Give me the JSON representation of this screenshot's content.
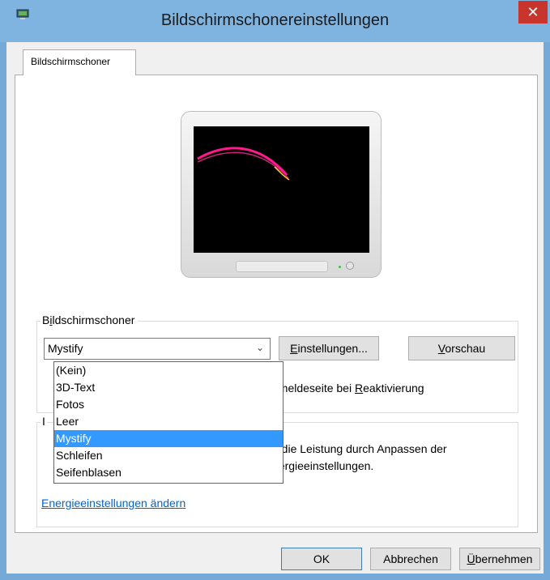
{
  "window": {
    "title": "Bildschirmschonereinstellungen",
    "close_glyph": "✕"
  },
  "tabs": [
    {
      "label": "Bildschirmschoner"
    }
  ],
  "screensaver": {
    "group_label_pre": "B",
    "group_label_accel": "i",
    "group_label_post": "ldschirmschoner",
    "selected": "Mystify",
    "settings_accel": "E",
    "settings_rest": "instellungen...",
    "preview_accel": "V",
    "preview_rest": "orschau",
    "resume_text_pre": "nmeldeseite bei ",
    "resume_text_accel": "R",
    "resume_text_post": "eaktivierung",
    "options": [
      "(Kein)",
      "3D-Text",
      "Fotos",
      "Leer",
      "Mystify",
      "Schleifen",
      "Seifenblasen"
    ]
  },
  "energy": {
    "group_label_fragment": "I",
    "text_line1": "e die Leistung durch Anpassen der",
    "text_line2": "nergieeinstellungen.",
    "link": "Energieeinstellungen ändern"
  },
  "footer": {
    "ok": "OK",
    "cancel": "Abbrechen",
    "apply_accel": "Ü",
    "apply_rest": "bernehmen"
  },
  "colors": {
    "titlebar": "#7fb3e0",
    "close_button": "#c7352d",
    "selection": "#3399ff",
    "link": "#0066cc"
  },
  "icons": [
    "app-icon",
    "close-icon",
    "chevron-down-icon"
  ]
}
